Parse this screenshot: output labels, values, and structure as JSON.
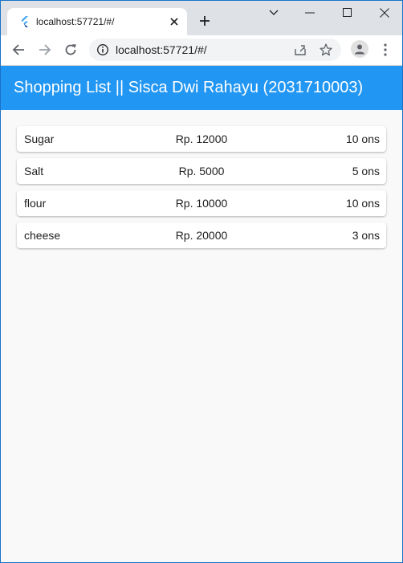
{
  "browser": {
    "tab": {
      "title": "localhost:57721/#/",
      "favicon": "flutter-icon"
    },
    "address_bar": {
      "url": "localhost:57721/#/"
    },
    "colors": {
      "tabstrip": "#dee1e6",
      "accent": "#2196f3"
    }
  },
  "app": {
    "title": "Shopping List || Sisca Dwi Rahayu (2031710003)",
    "items": [
      {
        "name": "Sugar",
        "price": "Rp. 12000",
        "qty": "10 ons"
      },
      {
        "name": "Salt",
        "price": "Rp. 5000",
        "qty": "5 ons"
      },
      {
        "name": "flour",
        "price": "Rp. 10000",
        "qty": "10 ons"
      },
      {
        "name": "cheese",
        "price": "Rp. 20000",
        "qty": "3 ons"
      }
    ]
  }
}
